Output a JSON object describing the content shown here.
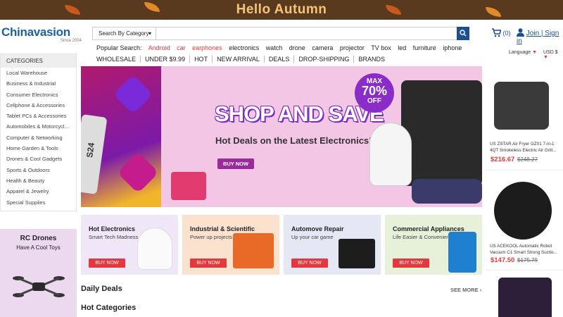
{
  "banner": {
    "title": "Hello Autumn"
  },
  "header": {
    "logo": "Chinavasion",
    "logo_sub": "Since 2004",
    "search": {
      "category": "Search By Category",
      "value": "",
      "placeholder": ""
    },
    "cart_count": "(0)",
    "account": "Join | Sign in",
    "popular_label": "Popular Search:",
    "popular_searches": [
      "Android",
      "car",
      "earphones",
      "electronics",
      "watch",
      "drone",
      "camera",
      "projector",
      "TV box",
      "led",
      "furniture",
      "iphone"
    ],
    "nav": [
      "WHOLESALE",
      "UNDER $9.99",
      "HOT",
      "NEW ARRIVAL",
      "DEALS",
      "DROP-SHIPPING",
      "BRANDS"
    ],
    "language": "Language",
    "currency": "USD $"
  },
  "sidebar": {
    "heading": "CATEGORIES",
    "items": [
      "Local Warehouse",
      "Business & Industrial",
      "Consumer Electronics",
      "Cellphone & Accessories",
      "Tablet PCs & Accessories",
      "Automobiles & Motorcycl...",
      "Computer & Networking",
      "Home Garden & Tools",
      "Drones & Cool Gadgets",
      "Sports & Outdoors",
      "Health & Beauty",
      "Apparel & Jewelry",
      "Special Supplies"
    ]
  },
  "hero": {
    "heading": "SHOP AND SAVE",
    "subheading": "Hot Deals on the Latest Electronics!",
    "button": "BUY NOW",
    "badge": {
      "line1": "MAX",
      "line2": "70%",
      "line3": "OFF"
    },
    "phone_label": "S24"
  },
  "tiles": [
    {
      "title": "Hot Electronics",
      "subtitle": "Smart Tech Madness",
      "button": "BUY NOW",
      "bg": "#efe6f7",
      "art": "#f5f5f5"
    },
    {
      "title": "Industrial & Scientific",
      "subtitle": "Power up projects",
      "button": "BUY NOW",
      "bg": "#fbe2cf",
      "art": "#e86a26"
    },
    {
      "title": "Automove Repair",
      "subtitle": "Up your car game",
      "button": "BUY NOW",
      "bg": "#e5e8f4",
      "art": "#1d1d1d"
    },
    {
      "title": "Commercial Appliances",
      "subtitle": "Life Easier & Convenient",
      "button": "BUY NOW",
      "bg": "#e7f0d8",
      "art": "#1f7fd1"
    }
  ],
  "promo": {
    "title": "RC Drones",
    "subtitle": "Have A Cool Toys"
  },
  "sections": {
    "daily": "Daily Deals",
    "see_more": "SEE MORE",
    "hot_categories": "Hot Categories"
  },
  "products": [
    {
      "name": "US ZSTAR Air Fryer GZ01 7-in-1 4QT Smokeless Electric Air Grill...",
      "price": "$216.67",
      "old_price": "$248.27"
    },
    {
      "name": "US ACEKOOL Automatic Robot Vacuum C1 Smart Strong Suctio...",
      "price": "$147.50",
      "old_price": "$175.79"
    }
  ],
  "colors": {
    "accent": "#e4393c",
    "brand": "#1d4f91"
  }
}
